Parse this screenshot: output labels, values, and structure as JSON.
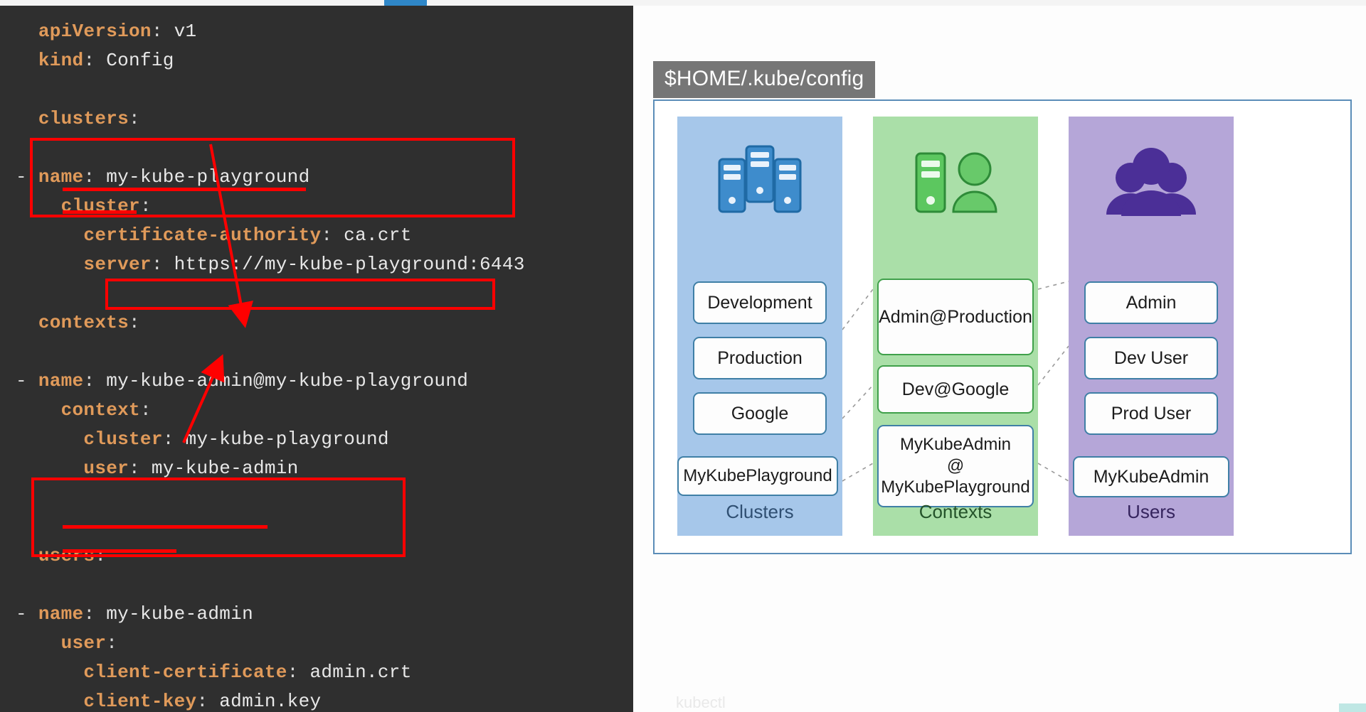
{
  "yaml": {
    "lines": [
      {
        "indent": 0,
        "key": "apiVersion",
        "value": "v1",
        "dash": false
      },
      {
        "indent": 0,
        "key": "kind",
        "value": "Config",
        "dash": false
      },
      {
        "indent": 0,
        "key": "",
        "value": "",
        "dash": false
      },
      {
        "indent": 0,
        "key": "clusters",
        "value": "",
        "dash": false
      },
      {
        "indent": 0,
        "key": "",
        "value": "",
        "dash": false
      },
      {
        "indent": 0,
        "key": "name",
        "value": "my-kube-playground",
        "dash": true
      },
      {
        "indent": 2,
        "key": "cluster",
        "value": "",
        "dash": false
      },
      {
        "indent": 4,
        "key": "certificate-authority",
        "value": "ca.crt",
        "dash": false
      },
      {
        "indent": 4,
        "key": "server",
        "value": "https://my-kube-playground:6443",
        "dash": false
      },
      {
        "indent": 0,
        "key": "",
        "value": "",
        "dash": false
      },
      {
        "indent": 0,
        "key": "contexts",
        "value": "",
        "dash": false
      },
      {
        "indent": 0,
        "key": "",
        "value": "",
        "dash": false
      },
      {
        "indent": 0,
        "key": "name",
        "value": "my-kube-admin@my-kube-playground",
        "dash": true
      },
      {
        "indent": 2,
        "key": "context",
        "value": "",
        "dash": false
      },
      {
        "indent": 4,
        "key": "cluster",
        "value": "my-kube-playground",
        "dash": false
      },
      {
        "indent": 4,
        "key": "user",
        "value": "my-kube-admin",
        "dash": false
      },
      {
        "indent": 0,
        "key": "",
        "value": "",
        "dash": false
      },
      {
        "indent": 0,
        "key": "",
        "value": "",
        "dash": false
      },
      {
        "indent": 0,
        "key": "users",
        "value": "",
        "dash": false
      },
      {
        "indent": 0,
        "key": "",
        "value": "",
        "dash": false
      },
      {
        "indent": 0,
        "key": "name",
        "value": "my-kube-admin",
        "dash": true
      },
      {
        "indent": 2,
        "key": "user",
        "value": "",
        "dash": false
      },
      {
        "indent": 4,
        "key": "client-certificate",
        "value": "admin.crt",
        "dash": false
      },
      {
        "indent": 4,
        "key": "client-key",
        "value": "admin.key",
        "dash": false
      }
    ],
    "annotation_color": "#ff0000"
  },
  "diagram": {
    "file_tag": "$HOME/.kube/config",
    "columns": [
      {
        "name": "clusters",
        "title": "Clusters",
        "icon": "servers-icon",
        "accent": "#a6c7ea",
        "items": [
          "Development",
          "Production",
          "Google",
          "MyKubePlayground"
        ]
      },
      {
        "name": "contexts",
        "title": "Contexts",
        "icon": "server-user-icon",
        "accent": "#aadfa8",
        "items": [
          "Admin@Production",
          "Dev@Google",
          "MyKubeAdmin\n@\nMyKubePlayground"
        ]
      },
      {
        "name": "users",
        "title": "Users",
        "icon": "users-group-icon",
        "accent": "#b5a6d8",
        "items": [
          "Admin",
          "Dev User",
          "Prod User",
          "MyKubeAdmin"
        ]
      }
    ],
    "links": [
      {
        "from": "Production",
        "to": "Admin@Production"
      },
      {
        "from": "Google",
        "to": "Dev@Google"
      },
      {
        "from": "MyKubePlayground",
        "to": "MyKubeAdmin@MyKubePlayground"
      },
      {
        "from": "Admin@Production",
        "to": "Admin"
      },
      {
        "from": "Dev@Google",
        "to": "Dev User"
      },
      {
        "from": "MyKubeAdmin@MyKubePlayground",
        "to": "MyKubeAdmin"
      }
    ]
  },
  "footer": {
    "ghost_text": "kubectl"
  }
}
